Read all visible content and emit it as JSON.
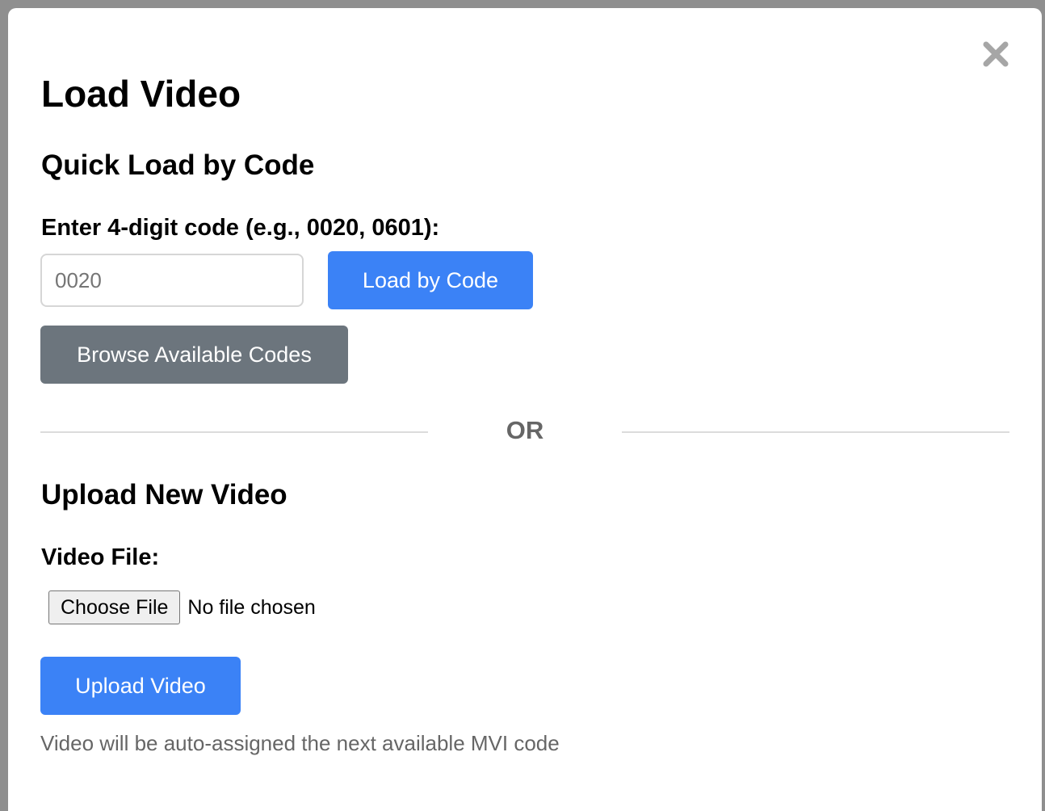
{
  "modal": {
    "title": "Load Video",
    "close_icon": "close-icon"
  },
  "quick_load": {
    "heading": "Quick Load by Code",
    "code_label": "Enter 4-digit code (e.g., 0020, 0601):",
    "code_placeholder": "0020",
    "code_value": "",
    "load_button": "Load by Code",
    "browse_button": "Browse Available Codes"
  },
  "divider": {
    "text": "OR"
  },
  "upload": {
    "heading": "Upload New Video",
    "file_label": "Video File:",
    "choose_file_button": "Choose File",
    "file_status": "No file chosen",
    "upload_button": "Upload Video",
    "hint": "Video will be auto-assigned the next available MVI code"
  },
  "colors": {
    "primary": "#3b82f6",
    "secondary": "#6c757d",
    "overlay": "#8f8f8f",
    "muted_text": "#666666"
  }
}
